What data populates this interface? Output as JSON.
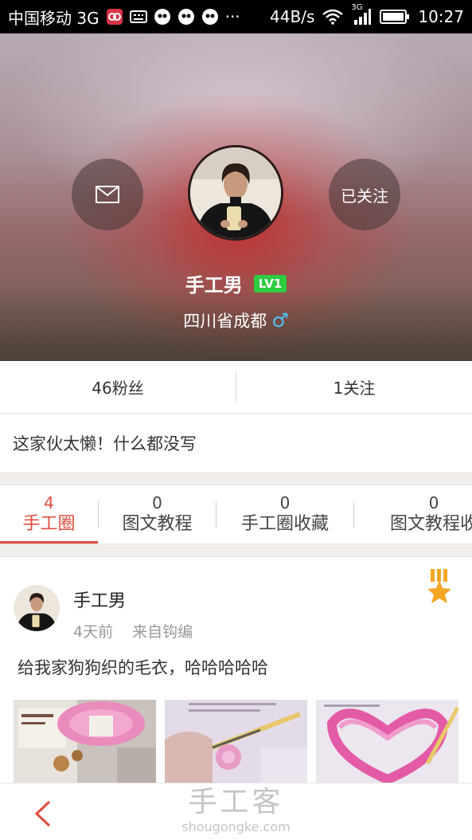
{
  "status_bar": {
    "carrier": "中国移动 3G",
    "speed": "44B/s",
    "signal_label": "3G",
    "time": "10:27",
    "more": "···"
  },
  "profile": {
    "name": "手工男",
    "level": "LV1",
    "location": "四川省成都",
    "gender_symbol": "♂",
    "follow_button": "已关注",
    "message_icon": "envelope-icon",
    "bio": "这家伙太懒！什么都没写"
  },
  "stats": {
    "fans": "46粉丝",
    "following": "1关注"
  },
  "tabs": [
    {
      "count": "4",
      "label": "手工圈"
    },
    {
      "count": "0",
      "label": "图文教程"
    },
    {
      "count": "0",
      "label": "手工圈收藏"
    },
    {
      "count": "0",
      "label": "图文教程收"
    }
  ],
  "post": {
    "author": "手工男",
    "time_ago": "4天前",
    "source": "来自钩编",
    "text": "给我家狗狗织的毛衣，哈哈哈哈哈",
    "medal_icon": "medal-icon"
  },
  "bottom_bar": {
    "back_icon": "chevron-left-icon",
    "watermark_cn": "手工客",
    "watermark_en": "shougongke.com"
  },
  "colors": {
    "accent": "#e04b3c",
    "level_badge": "#2ecc40",
    "gender": "#4fc3f7",
    "medal": "#f5a623"
  }
}
